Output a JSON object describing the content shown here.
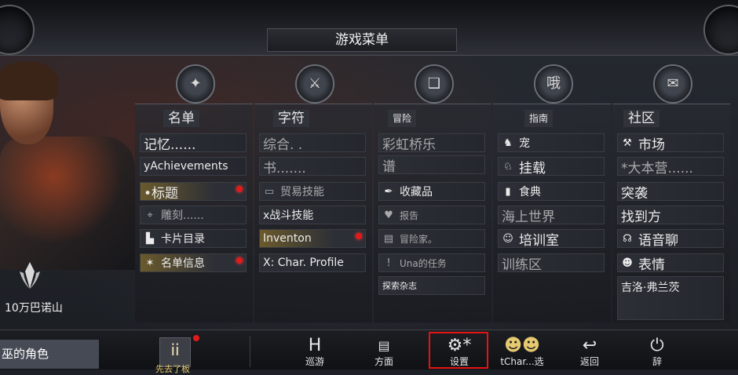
{
  "window": {
    "title": "游戏菜单"
  },
  "character": {
    "region": "10万巴诺山"
  },
  "columns": [
    {
      "header": "名单",
      "items": [
        {
          "label": "记忆......",
          "icon": "none",
          "style": "big"
        },
        {
          "label": "yAchievements",
          "icon": "none"
        },
        {
          "label": "•标题",
          "icon": "title-icon",
          "badge": "red-dot",
          "style": "hl"
        },
        {
          "label": "雕刻......",
          "icon": "crosshair-icon",
          "style": "dim"
        },
        {
          "label": "卡片目录",
          "icon": "card-icon"
        },
        {
          "label": "名单信息",
          "icon": "star-icon",
          "badge": "red-dot",
          "style": "hl"
        }
      ]
    },
    {
      "header": "字符",
      "items": [
        {
          "label": "综合. .",
          "icon": "none",
          "style": "big"
        },
        {
          "label": "书.......",
          "icon": "none",
          "style": "big"
        },
        {
          "label": "贸易技能",
          "icon": "book-icon",
          "style": "dim"
        },
        {
          "label": "x战斗技能",
          "icon": "none"
        },
        {
          "label": "Inventon",
          "icon": "none",
          "badge": "red-dot",
          "style": "hl"
        },
        {
          "label": "X: Char. Profile",
          "icon": "none"
        }
      ]
    },
    {
      "header": "冒险",
      "items": [
        {
          "label": "彩虹桥乐",
          "icon": "none",
          "style": "big"
        },
        {
          "label": "谱",
          "icon": "none",
          "style": "big"
        },
        {
          "label": "收藏品",
          "icon": "feather-icon"
        },
        {
          "label": "报告",
          "icon": "heart-icon",
          "style": "dim"
        },
        {
          "label": "冒险家。",
          "icon": "scroll-icon",
          "style": "dim"
        },
        {
          "label": "Una的任务",
          "icon": "exclamation-icon",
          "style": "dim"
        },
        {
          "label": "探索杂志",
          "icon": "none"
        }
      ]
    },
    {
      "header": "指南",
      "items": [
        {
          "label": "宠",
          "icon": "pet-icon"
        },
        {
          "label": "挂载",
          "icon": "mount-icon",
          "style": "big"
        },
        {
          "label": "食典",
          "icon": "book-icon"
        },
        {
          "label": "海上世界",
          "icon": "none",
          "style": "big"
        },
        {
          "label": "培训室",
          "icon": "trainer-icon",
          "style": "big"
        },
        {
          "label": "训练区",
          "icon": "none",
          "style": "big"
        }
      ]
    },
    {
      "header": "社区",
      "items": [
        {
          "label": "市场",
          "icon": "gavel-icon",
          "style": "big"
        },
        {
          "label": "*大本营......",
          "icon": "none",
          "style": "big"
        },
        {
          "label": "突袭",
          "icon": "none",
          "style": "big"
        },
        {
          "label": "找到方",
          "icon": "none",
          "style": "big"
        },
        {
          "label": "语音聊",
          "icon": "headset-icon"
        },
        {
          "label": "表情",
          "icon": "emote-icon"
        },
        {
          "label": "吉洛·弗兰茨",
          "icon": "none"
        }
      ]
    }
  ],
  "bottom": {
    "my_role": "巫的角色",
    "hot_label": "先去了板",
    "buttons": [
      {
        "label": "巡游",
        "icon": "H"
      },
      {
        "label": "方面",
        "icon": "doc-icon"
      },
      {
        "label": "设置",
        "icon": "settings-icon"
      },
      {
        "label": "tChar...选",
        "icon": "character-select-icon"
      },
      {
        "label": "返回",
        "icon": "back-icon"
      },
      {
        "label": "辞",
        "icon": "power-icon"
      }
    ]
  },
  "colors": {
    "accent": "#e51414",
    "badge": "#e21a1a",
    "highlight": "#6b5a2c"
  }
}
